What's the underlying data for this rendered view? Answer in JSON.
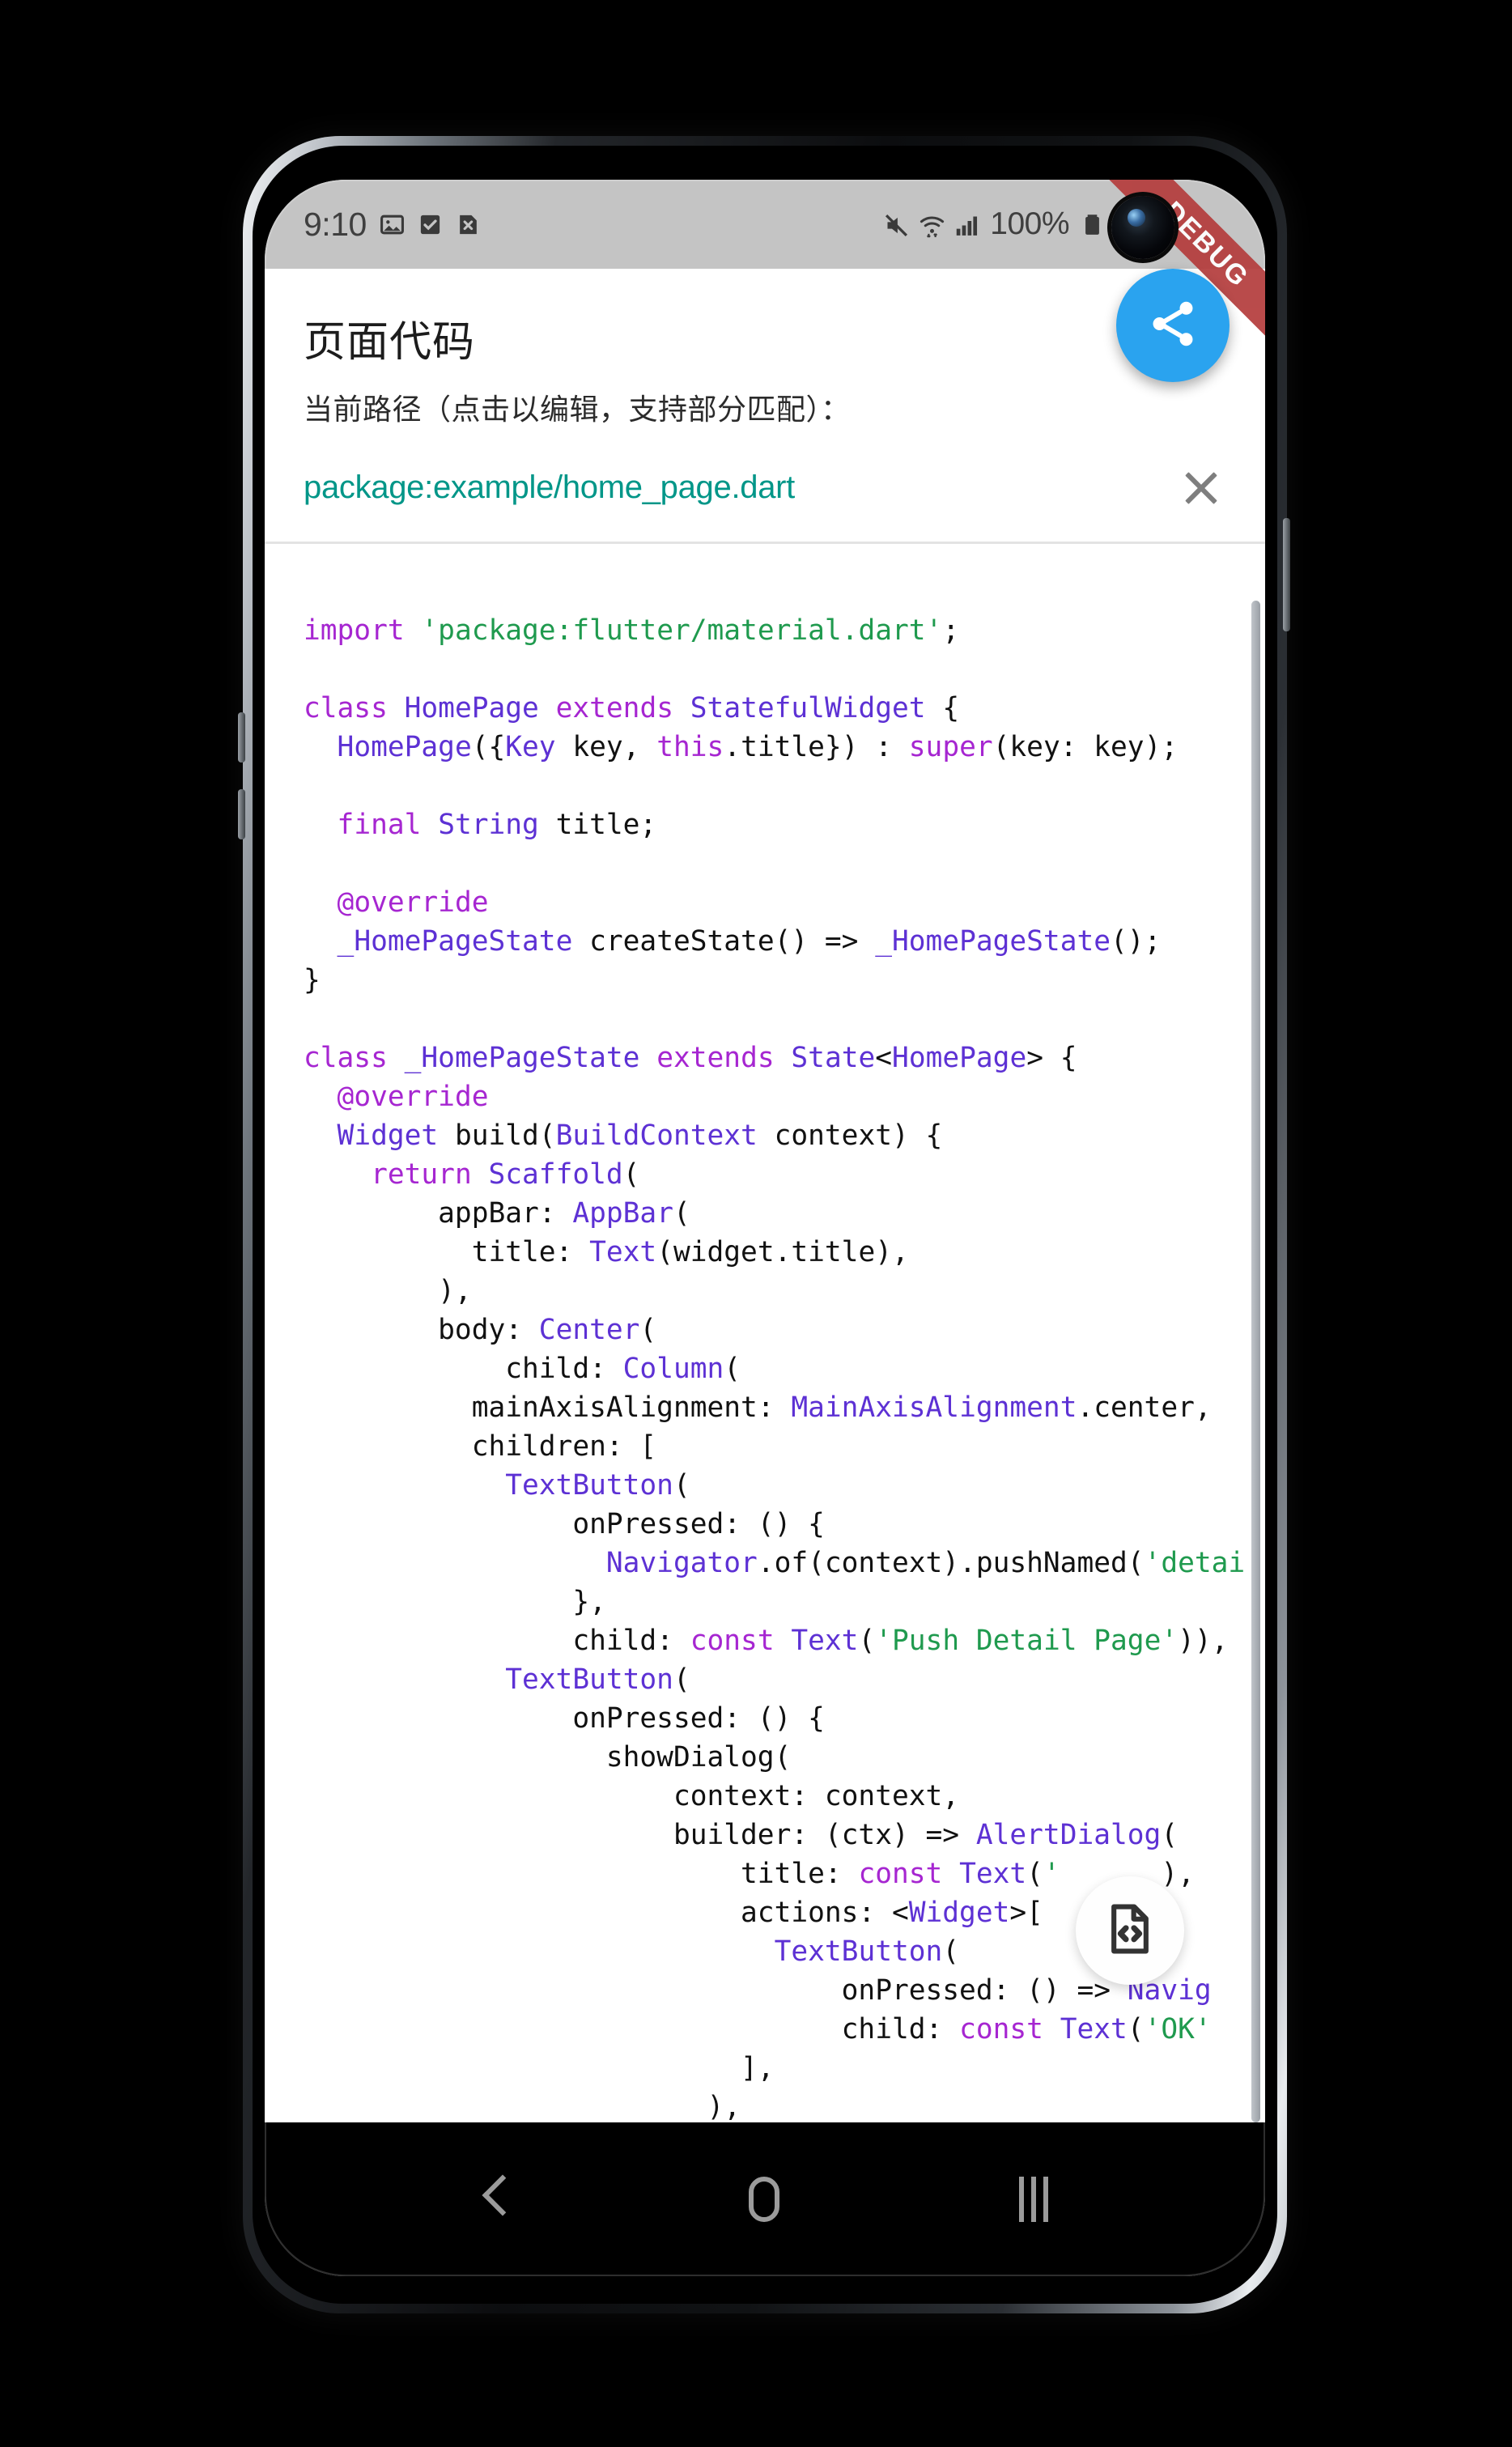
{
  "device": {
    "nav": {
      "back_label": "back",
      "home_label": "home",
      "recents_label": "recents"
    }
  },
  "status_bar": {
    "time": "9:10",
    "icons": [
      "image-icon",
      "checkbox-icon",
      "file-x-icon"
    ],
    "mute_icon": "mute-icon",
    "wifi_icon": "wifi-icon",
    "signal_icon": "cellular-signal-icon",
    "battery_percent": "100%",
    "battery_icon": "battery-full-icon"
  },
  "debug_banner": {
    "label": "DEBUG",
    "color": "#b43c3c"
  },
  "header": {
    "title": "页面代码",
    "hint": "当前路径（点击以编辑，支持部分匹配）：",
    "path": "package:example/home_page.dart",
    "path_color": "#009688",
    "close_icon": "close-icon"
  },
  "fab": {
    "share_icon": "share-icon",
    "share_color": "#2aa3ef",
    "code_icon": "file-code-icon",
    "code_color": "#fefefe"
  },
  "code": {
    "language": "dart",
    "lines": [
      [
        [
          "kw",
          "import"
        ],
        [
          "pl",
          " "
        ],
        [
          "str",
          "'package:flutter/material.dart'"
        ],
        [
          "pl",
          ";"
        ]
      ],
      [],
      [
        [
          "kw",
          "class"
        ],
        [
          "pl",
          " "
        ],
        [
          "typ",
          "HomePage"
        ],
        [
          "pl",
          " "
        ],
        [
          "kw",
          "extends"
        ],
        [
          "pl",
          " "
        ],
        [
          "typ",
          "StatefulWidget"
        ],
        [
          "pl",
          " {"
        ]
      ],
      [
        [
          "pl",
          "  "
        ],
        [
          "typ",
          "HomePage"
        ],
        [
          "pl",
          "({"
        ],
        [
          "typ",
          "Key"
        ],
        [
          "pl",
          " key, "
        ],
        [
          "kw",
          "this"
        ],
        [
          "pl",
          ".title}) : "
        ],
        [
          "kw",
          "super"
        ],
        [
          "pl",
          "(key: key);"
        ]
      ],
      [],
      [
        [
          "pl",
          "  "
        ],
        [
          "kw",
          "final"
        ],
        [
          "pl",
          " "
        ],
        [
          "typ",
          "String"
        ],
        [
          "pl",
          " title;"
        ]
      ],
      [],
      [
        [
          "pl",
          "  "
        ],
        [
          "ann",
          "@override"
        ]
      ],
      [
        [
          "pl",
          "  "
        ],
        [
          "typ",
          "_HomePageState"
        ],
        [
          "pl",
          " createState() => "
        ],
        [
          "typ",
          "_HomePageState"
        ],
        [
          "pl",
          "();"
        ]
      ],
      [
        [
          "pl",
          "}"
        ]
      ],
      [],
      [
        [
          "kw",
          "class"
        ],
        [
          "pl",
          " "
        ],
        [
          "typ",
          "_HomePageState"
        ],
        [
          "pl",
          " "
        ],
        [
          "kw",
          "extends"
        ],
        [
          "pl",
          " "
        ],
        [
          "typ",
          "State"
        ],
        [
          "pl",
          "<"
        ],
        [
          "typ",
          "HomePage"
        ],
        [
          "pl",
          "> {"
        ]
      ],
      [
        [
          "pl",
          "  "
        ],
        [
          "ann",
          "@override"
        ]
      ],
      [
        [
          "pl",
          "  "
        ],
        [
          "typ",
          "Widget"
        ],
        [
          "pl",
          " build("
        ],
        [
          "typ",
          "BuildContext"
        ],
        [
          "pl",
          " context) {"
        ]
      ],
      [
        [
          "pl",
          "    "
        ],
        [
          "kw",
          "return"
        ],
        [
          "pl",
          " "
        ],
        [
          "typ",
          "Scaffold"
        ],
        [
          "pl",
          "("
        ]
      ],
      [
        [
          "pl",
          "        appBar: "
        ],
        [
          "typ",
          "AppBar"
        ],
        [
          "pl",
          "("
        ]
      ],
      [
        [
          "pl",
          "          title: "
        ],
        [
          "typ",
          "Text"
        ],
        [
          "pl",
          "(widget.title),"
        ]
      ],
      [
        [
          "pl",
          "        ),"
        ]
      ],
      [
        [
          "pl",
          "        body: "
        ],
        [
          "typ",
          "Center"
        ],
        [
          "pl",
          "("
        ]
      ],
      [
        [
          "pl",
          "            child: "
        ],
        [
          "typ",
          "Column"
        ],
        [
          "pl",
          "("
        ]
      ],
      [
        [
          "pl",
          "          mainAxisAlignment: "
        ],
        [
          "typ",
          "MainAxisAlignment"
        ],
        [
          "pl",
          ".center,"
        ]
      ],
      [
        [
          "pl",
          "          children: ["
        ]
      ],
      [
        [
          "pl",
          "            "
        ],
        [
          "typ",
          "TextButton"
        ],
        [
          "pl",
          "("
        ]
      ],
      [
        [
          "pl",
          "                onPressed: () {"
        ]
      ],
      [
        [
          "pl",
          "                  "
        ],
        [
          "typ",
          "Navigator"
        ],
        [
          "pl",
          ".of(context).pushNamed("
        ],
        [
          "str",
          "'detai"
        ]
      ],
      [
        [
          "pl",
          "                },"
        ]
      ],
      [
        [
          "pl",
          "                child: "
        ],
        [
          "kw",
          "const"
        ],
        [
          "pl",
          " "
        ],
        [
          "typ",
          "Text"
        ],
        [
          "pl",
          "("
        ],
        [
          "str",
          "'Push Detail Page'"
        ],
        [
          "pl",
          ")),"
        ]
      ],
      [
        [
          "pl",
          "            "
        ],
        [
          "typ",
          "TextButton"
        ],
        [
          "pl",
          "("
        ]
      ],
      [
        [
          "pl",
          "                onPressed: () {"
        ]
      ],
      [
        [
          "pl",
          "                  showDialog("
        ]
      ],
      [
        [
          "pl",
          "                      context: context,"
        ]
      ],
      [
        [
          "pl",
          "                      builder: (ctx) => "
        ],
        [
          "typ",
          "AlertDialog"
        ],
        [
          "pl",
          "("
        ]
      ],
      [
        [
          "pl",
          "                          title: "
        ],
        [
          "kw",
          "const"
        ],
        [
          "pl",
          " "
        ],
        [
          "typ",
          "Text"
        ],
        [
          "pl",
          "("
        ],
        [
          "str",
          "'"
        ],
        [
          "pl",
          "      ),"
        ]
      ],
      [
        [
          "pl",
          "                          actions: <"
        ],
        [
          "typ",
          "Widget"
        ],
        [
          "pl",
          ">["
        ]
      ],
      [
        [
          "pl",
          "                            "
        ],
        [
          "typ",
          "TextButton"
        ],
        [
          "pl",
          "("
        ]
      ],
      [
        [
          "pl",
          "                                onPressed: () => "
        ],
        [
          "typ",
          "Navig"
        ]
      ],
      [
        [
          "pl",
          "                                child: "
        ],
        [
          "kw",
          "const"
        ],
        [
          "pl",
          " "
        ],
        [
          "typ",
          "Text"
        ],
        [
          "pl",
          "("
        ],
        [
          "str",
          "'OK'"
        ]
      ],
      [
        [
          "pl",
          "                          ],"
        ]
      ],
      [
        [
          "pl",
          "                        ),"
        ]
      ]
    ]
  }
}
